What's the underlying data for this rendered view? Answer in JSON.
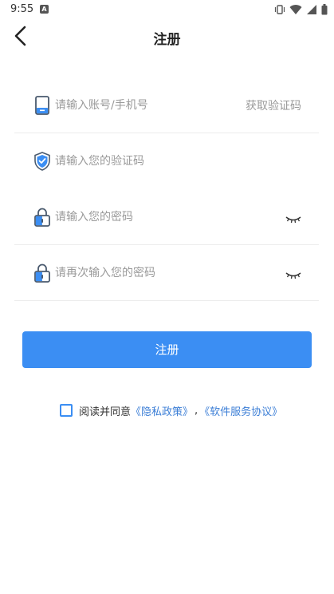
{
  "status_bar": {
    "time": "9:55",
    "notification_letter": "A"
  },
  "header": {
    "title": "注册"
  },
  "form": {
    "account": {
      "placeholder": "请输入账号/手机号",
      "get_code_label": "获取验证码"
    },
    "code": {
      "placeholder": "请输入您的验证码"
    },
    "password": {
      "placeholder": "请输入您的密码"
    },
    "confirm_password": {
      "placeholder": "请再次输入您的密码"
    }
  },
  "submit": {
    "label": "注册"
  },
  "agreement": {
    "prefix": "阅读并同意",
    "privacy_link": "《隐私政策》",
    "separator": ",",
    "service_link": "《软件服务协议》"
  },
  "colors": {
    "accent": "#3b8ef3",
    "link": "#3b7ed6",
    "placeholder": "#9a9a9a"
  }
}
